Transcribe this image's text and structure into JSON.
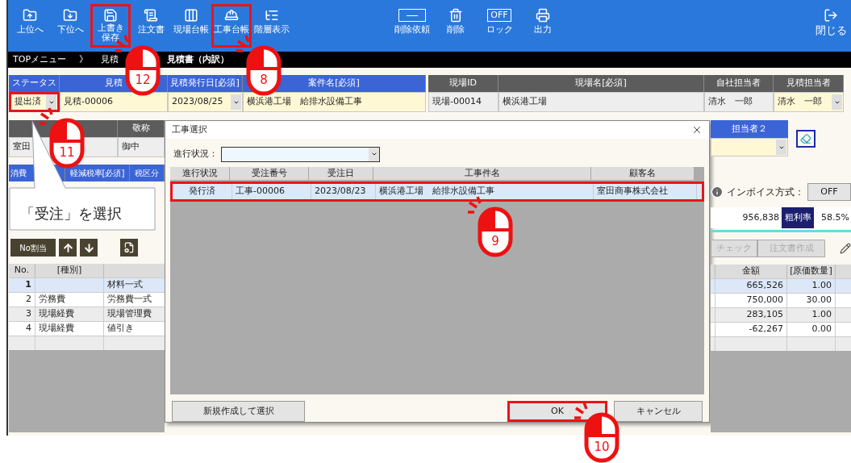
{
  "toolbar": {
    "left": [
      {
        "label": "上位へ",
        "kind": "up",
        "highlighted": false
      },
      {
        "label": "下位へ",
        "kind": "down",
        "highlighted": false
      },
      {
        "label": "上書き保存",
        "kind": "save",
        "highlighted": true,
        "step": "12"
      },
      {
        "label": "注文書",
        "kind": "order",
        "highlighted": false
      },
      {
        "label": "現場台帳",
        "kind": "ledger",
        "highlighted": false
      },
      {
        "label": "工事台帳",
        "kind": "work",
        "highlighted": true,
        "step": "8"
      },
      {
        "label": "階層表示",
        "kind": "tree",
        "highlighted": false
      }
    ],
    "center": [
      {
        "label": "削除依頼",
        "kind": "request",
        "highlighted": false
      },
      {
        "label": "削除",
        "kind": "delete",
        "highlighted": false
      },
      {
        "label": "ロック",
        "kind": "lock",
        "icon_text": "OFF",
        "highlighted": false
      },
      {
        "label": "出力",
        "kind": "print",
        "highlighted": false
      }
    ],
    "right": [
      {
        "label": "閉じる",
        "kind": "close",
        "highlighted": false
      }
    ]
  },
  "breadcrumb": [
    {
      "text": "TOPメニュー"
    },
    {
      "text": "》"
    },
    {
      "text": "見積"
    },
    {
      "text": "見積書（内訳）"
    }
  ],
  "estimate_header": {
    "columns": [
      "ステータス",
      "見積",
      "見積発行日[必須]",
      "案件名[必須]"
    ],
    "values": [
      {
        "text": "提出済",
        "editable": true,
        "dropdown": true,
        "highlighted": true,
        "step": "11"
      },
      {
        "text": "見積-00006",
        "editable": true,
        "dropdown": false,
        "highlighted": false
      },
      {
        "text": "2023/08/25",
        "editable": true,
        "dropdown": true,
        "highlighted": false
      },
      {
        "text": "横浜港工場　給排水設備工事",
        "editable": true,
        "dropdown": false,
        "highlighted": false
      }
    ]
  },
  "site_header": {
    "columns": [
      "現場ID",
      "現場名[必須]",
      "自社担当者",
      "見積担当者"
    ],
    "values": [
      {
        "text": "現場-00014",
        "editable": false,
        "dropdown": false,
        "highlighted": false
      },
      {
        "text": "横浜港工場",
        "editable": false,
        "dropdown": false,
        "highlighted": false
      },
      {
        "text": "清水　一郎",
        "editable": false,
        "dropdown": false,
        "highlighted": false
      },
      {
        "text": "清水　一郎",
        "editable": true,
        "dropdown": true,
        "highlighted": false
      }
    ]
  },
  "customer": {
    "honorific_header": "敬称",
    "values": [
      "室田",
      "御中"
    ]
  },
  "tax": {
    "columns": [
      "消費",
      "軽減税率[必須]",
      "税区分"
    ]
  },
  "callout": "「受注」を選択",
  "person2": {
    "label": "担当者２"
  },
  "invoice": {
    "label": "インボイス方式：",
    "button": "OFF"
  },
  "totals": {
    "amount": "956,838",
    "rate_label": "粗利率",
    "rate": "58.5%"
  },
  "actions_left": {
    "assign": "No割当"
  },
  "actions_right": [
    {
      "label": "チェック",
      "disabled": true
    },
    {
      "label": "注文書作成",
      "disabled": true
    }
  ],
  "detail_table": {
    "columns": {
      "no": "No.",
      "category": "[種別]",
      "amount": "金額",
      "quantity": "[原価数量]"
    },
    "rows": [
      {
        "no": "1",
        "item": "材料一式",
        "amount": "665,526",
        "quantity": "1.00",
        "selected": true
      },
      {
        "no": "2",
        "category": "労務費",
        "item": "労務費一式",
        "amount": "750,000",
        "quantity": "30.00",
        "selected": false
      },
      {
        "no": "3",
        "category": "現場経費",
        "item": "現場管理費",
        "amount": "283,105",
        "quantity": "1.00",
        "selected": false
      },
      {
        "no": "4",
        "category": "現場経費",
        "item": "値引き",
        "amount": "-62,267",
        "quantity": "0.00",
        "selected": false
      }
    ]
  },
  "dialog": {
    "title": "工事選択",
    "filter_label": "進行状況：",
    "columns": [
      "進行状況",
      "受注番号",
      "受注日",
      "工事件名",
      "顧客名"
    ],
    "rows": [
      {
        "cells": [
          "発行済",
          "工事-00006",
          "2023/08/23",
          "横浜港工場　給排水設備工事",
          "室田商事株式会社"
        ],
        "selected": true,
        "highlighted": true,
        "step": "9"
      }
    ],
    "buttons": [
      {
        "label": "新規作成して選択",
        "highlighted": false
      },
      {
        "label": "OK",
        "highlighted": true,
        "step": "10"
      },
      {
        "label": "キャンセル",
        "highlighted": false
      }
    ]
  }
}
